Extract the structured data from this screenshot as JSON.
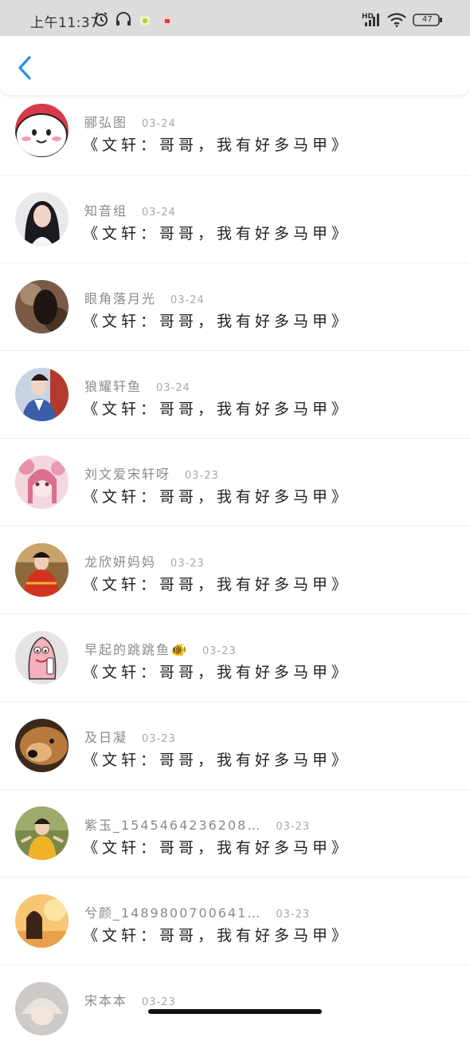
{
  "status_bar": {
    "time": "上午11:37",
    "network": "HD",
    "battery": "47",
    "icons": [
      "alarm-icon",
      "headset-icon",
      "app-notification-icon",
      "app-notification-icon",
      "signal-icon",
      "wifi-icon",
      "battery-icon"
    ]
  },
  "nav": {
    "back_icon": "chevron-left-icon",
    "accent_color": "#2a8ee8"
  },
  "comments": [
    {
      "name": "郦弘图",
      "date": "03-24",
      "message": "《文轩：哥哥，我有好多马甲》"
    },
    {
      "name": "知音组",
      "date": "03-24",
      "message": "《文轩：哥哥，我有好多马甲》"
    },
    {
      "name": "眼角落月光",
      "date": "03-24",
      "message": "《文轩：哥哥，我有好多马甲》"
    },
    {
      "name": "狼耀轩鱼",
      "date": "03-24",
      "message": "《文轩：哥哥，我有好多马甲》"
    },
    {
      "name": "刘文爱宋轩呀",
      "date": "03-23",
      "message": "《文轩：哥哥，我有好多马甲》"
    },
    {
      "name": "龙欣妍妈妈",
      "date": "03-23",
      "message": "《文轩：哥哥，我有好多马甲》"
    },
    {
      "name": "早起的跳跳鱼🐠",
      "date": "03-23",
      "message": "《文轩：哥哥，我有好多马甲》"
    },
    {
      "name": "及日凝",
      "date": "03-23",
      "message": "《文轩：哥哥，我有好多马甲》"
    },
    {
      "name": "紫玉_1545464236208…",
      "date": "03-23",
      "message": "《文轩：哥哥，我有好多马甲》"
    },
    {
      "name": "兮颜_1489800700641…",
      "date": "03-23",
      "message": "《文轩：哥哥，我有好多马甲》"
    },
    {
      "name": "宋本本",
      "date": "03-23",
      "message": ""
    }
  ]
}
